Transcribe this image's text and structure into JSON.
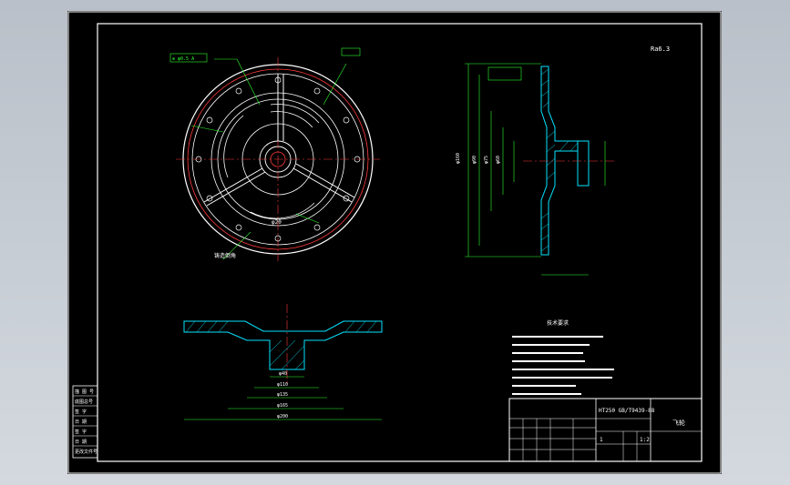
{
  "drawing": {
    "title_block": {
      "material": "HT250  GB/T9439-88",
      "part_name": "飞轮",
      "scale": "1:2",
      "sheet_count": "1"
    },
    "tech_req_title": "技术要求",
    "left_strip": [
      "描 图 号",
      "底图总号",
      "签 字",
      "日 期",
      "签 字",
      "日 期",
      "更改文件号"
    ],
    "labels": {
      "surface_mark": "Ra6.3",
      "section_note": "铸造倒角",
      "top_view_dim": "φ20",
      "side_dims": [
        "φ160",
        "φ90",
        "φ75",
        "φ60"
      ],
      "bottom_dims": [
        "φ40",
        "φ110",
        "φ135",
        "φ165",
        "φ200"
      ]
    }
  }
}
